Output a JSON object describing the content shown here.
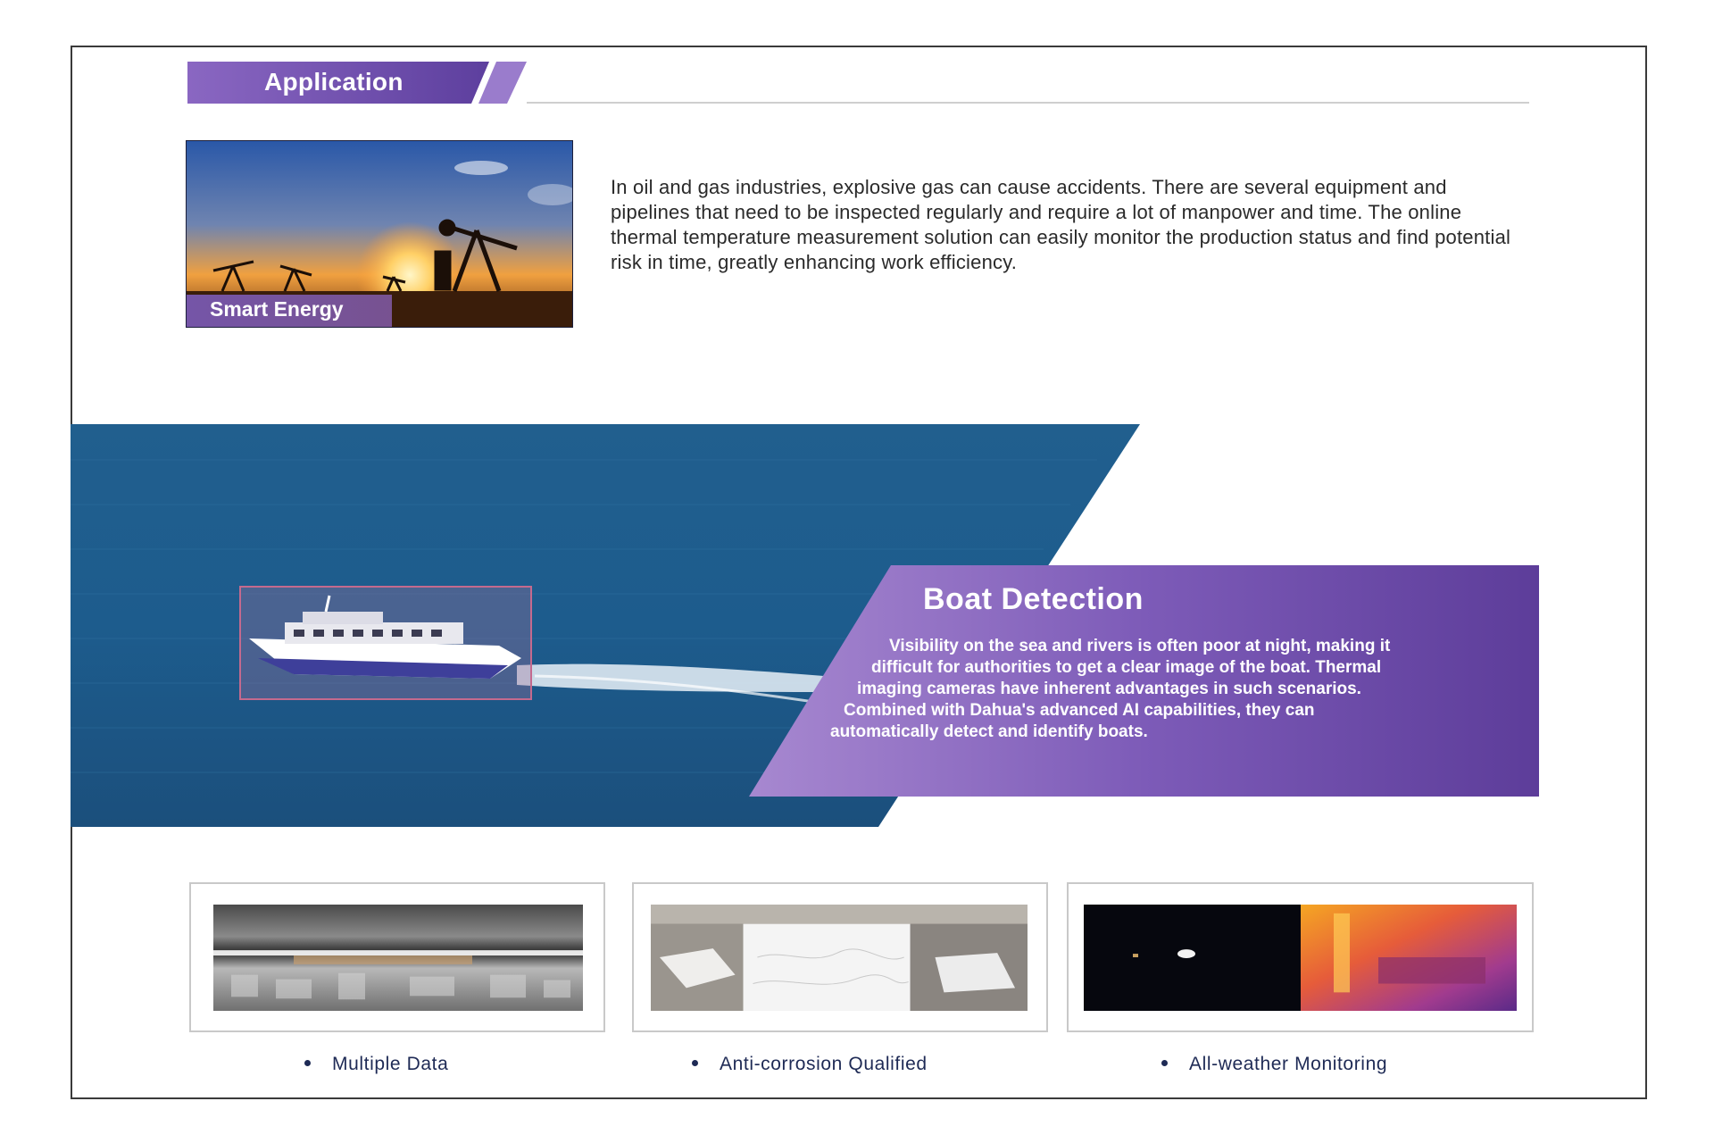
{
  "header": {
    "title": "Application"
  },
  "energy": {
    "label": "Smart Energy",
    "text": "In oil and gas industries, explosive gas can cause accidents. There are several equipment and pipelines that need to be inspected regularly and require a lot of manpower and time. The online thermal temperature measurement solution can easily monitor the production status and find potential risk in time, greatly enhancing work efficiency."
  },
  "boat": {
    "title": "Boat Detection",
    "lines": [
      "Visibility on the sea and rivers is often poor at night, making it",
      "difficult for authorities to get a clear image of the boat. Thermal",
      "imaging cameras have inherent advantages in such scenarios.",
      "Combined with Dahua's advanced AI capabilities, they can",
      "automatically detect and identify boats."
    ]
  },
  "features": [
    {
      "label": "Multiple Data"
    },
    {
      "label": "Anti-corrosion Qualified"
    },
    {
      "label": "All-weather Monitoring"
    }
  ],
  "colors": {
    "brand_purple": "#7b56b4",
    "sea_blue": "#1f5f8f",
    "caption_navy": "#1e2a55"
  }
}
